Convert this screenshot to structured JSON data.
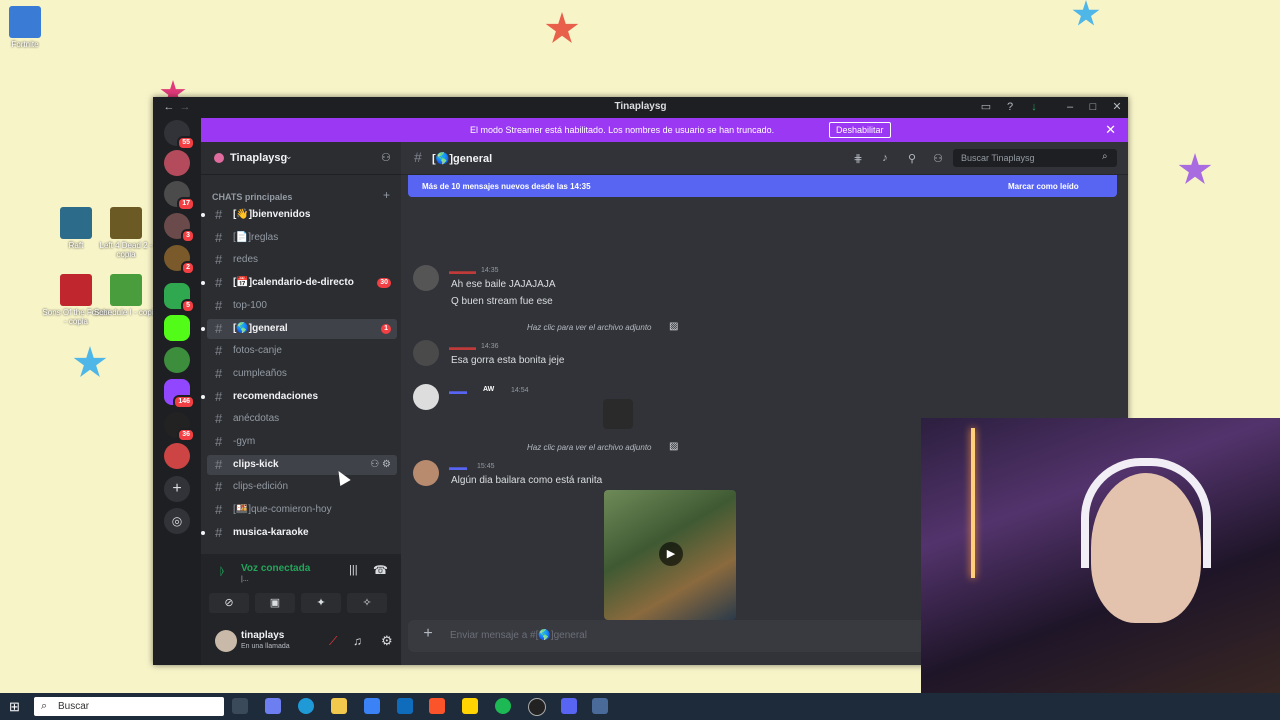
{
  "desktop": {
    "icons": [
      {
        "label": "Fortnite",
        "color": "#3a7bd5"
      },
      {
        "label": "Raft",
        "color": "#2d6b8a"
      },
      {
        "label": "Left 4 Dead 2 - copia",
        "color": "#6b5a24"
      },
      {
        "label": "Sons Of the Forest - copia",
        "color": "#c0262e"
      },
      {
        "label": "Schedule I - copia",
        "color": "#4a9d3c"
      }
    ]
  },
  "window": {
    "title": "Tinaplaysg"
  },
  "streamer_banner": {
    "text": "El modo Streamer está habilitado. Los nombres de usuario se han truncado.",
    "button": "Deshabilitar"
  },
  "server_list": {
    "badges": [
      "55",
      "17",
      "3",
      "2",
      "5",
      "146",
      "36"
    ]
  },
  "guild": {
    "name": "Tinaplaysg",
    "category": "CHATS principales",
    "channels": [
      {
        "label": "[👋]bienvenidos",
        "bold": true,
        "dot": true
      },
      {
        "label": "[📄]reglas",
        "bold": false
      },
      {
        "label": "redes",
        "bold": false
      },
      {
        "label": "[📅]calendario-de-directo",
        "bold": true,
        "dot": true,
        "count": "30"
      },
      {
        "label": "top-100",
        "bold": false
      },
      {
        "label": "[🌎]general",
        "bold": true,
        "dot": true,
        "count": "1",
        "selected": true
      },
      {
        "label": "fotos-canje",
        "bold": false
      },
      {
        "label": "cumpleaños",
        "bold": false
      },
      {
        "label": "recomendaciones",
        "bold": true,
        "dot": true
      },
      {
        "label": "anécdotas",
        "bold": false
      },
      {
        "label": "-gym",
        "bold": false
      },
      {
        "label": "clips-kick",
        "bold": true,
        "hover": true
      },
      {
        "label": "clips-edición",
        "bold": false
      },
      {
        "label": "[🍱]que-comieron-hoy",
        "bold": false
      },
      {
        "label": "musica-karaoke",
        "bold": true,
        "dot": true
      }
    ]
  },
  "voice": {
    "title": "Voz conectada",
    "sub": "|..."
  },
  "user": {
    "name": "tinaplays",
    "status": "En una llamada"
  },
  "chat": {
    "channel": "[🌎]general",
    "search_placeholder": "Buscar Tinaplaysg",
    "new_messages": "Más de 10 mensajes nuevos desde las 14:35",
    "mark_read": "Marcar como leído",
    "messages": [
      {
        "time": "14:35",
        "lines": [
          "Ah ese baile JAJAJAJA",
          "Q buen stream fue ese"
        ]
      },
      {
        "reply": "Haz clic para ver el archivo adjunto",
        "time": "14:36",
        "lines": [
          "Esa gorra esta bonita jeje"
        ]
      },
      {
        "time": "14:54",
        "lines": [],
        "tag": "AW"
      },
      {
        "reply": "Haz clic para ver el archivo adjunto",
        "time": "15:45",
        "lines": [
          "Algún dia bailara como está ranita"
        ]
      }
    ],
    "composer_placeholder": "Enviar mensaje a #[🌎]general"
  },
  "taskbar": {
    "search": "Buscar"
  }
}
